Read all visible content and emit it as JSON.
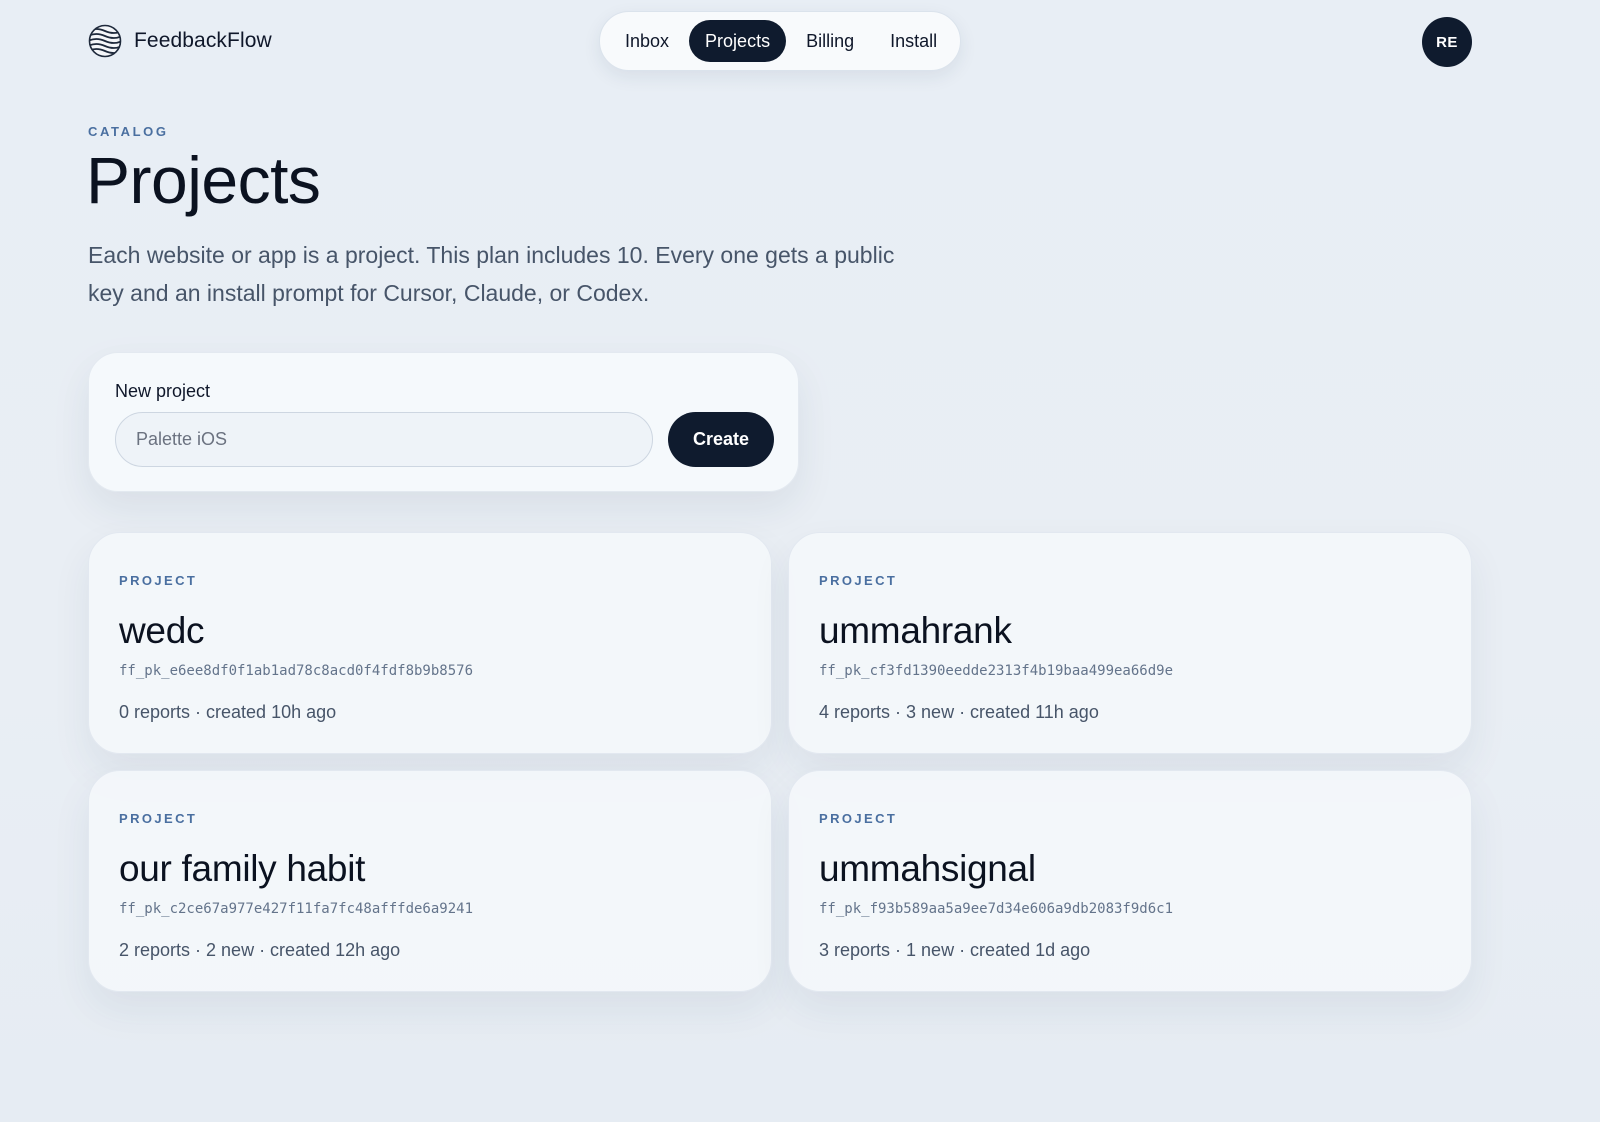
{
  "app": {
    "name": "FeedbackFlow",
    "logo_icon": "wave-globe-icon"
  },
  "nav": {
    "items": [
      {
        "label": "Inbox",
        "active": false
      },
      {
        "label": "Projects",
        "active": true
      },
      {
        "label": "Billing",
        "active": false
      },
      {
        "label": "Install",
        "active": false
      }
    ]
  },
  "user": {
    "initials": "RE"
  },
  "header": {
    "eyebrow": "CATALOG",
    "title": "Projects",
    "description": "Each website or app is a project. This plan includes 10. Every one gets a public key and an install prompt for Cursor, Claude, or Codex."
  },
  "new_project": {
    "label": "New project",
    "placeholder": "Palette iOS",
    "value": "",
    "create_label": "Create"
  },
  "projects": [
    {
      "eyebrow": "PROJECT",
      "name": "wedc",
      "key": "ff_pk_e6ee8df0f1ab1ad78c8acd0f4fdf8b9b8576",
      "meta": "0 reports · created 10h ago"
    },
    {
      "eyebrow": "PROJECT",
      "name": "ummahrank",
      "key": "ff_pk_cf3fd1390eedde2313f4b19baa499ea66d9e",
      "meta": "4 reports · 3 new · created 11h ago"
    },
    {
      "eyebrow": "PROJECT",
      "name": "our family habit",
      "key": "ff_pk_c2ce67a977e427f11fa7fc48afffde6a9241",
      "meta": "2 reports · 2 new · created 12h ago"
    },
    {
      "eyebrow": "PROJECT",
      "name": "ummahsignal",
      "key": "ff_pk_f93b589aa5a9ee7d34e606a9db2083f9d6c1",
      "meta": "3 reports · 1 new · created 1d ago"
    }
  ],
  "colors": {
    "accent_dark": "#0f1b2e",
    "eyebrow_blue": "#4a6fa0",
    "background": "#e8eef5"
  }
}
